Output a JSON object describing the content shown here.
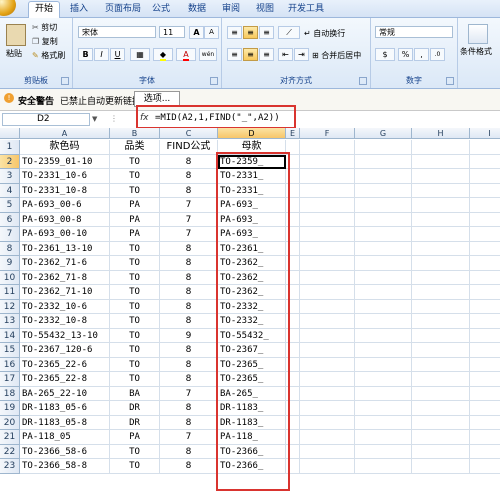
{
  "tabs": [
    "开始",
    "插入",
    "页面布局",
    "公式",
    "数据",
    "审阅",
    "视图",
    "开发工具"
  ],
  "ribbon": {
    "paste": "粘贴",
    "cut": "剪切",
    "copy": "复制",
    "format_painter": "格式刷",
    "clipboard_label": "剪贴板",
    "font_name": "宋体",
    "font_size": "11",
    "font_label": "字体",
    "bold": "B",
    "italic": "I",
    "underline": "U",
    "grow_font": "A",
    "shrink_font": "A",
    "wen": "wén",
    "font_color": "A",
    "wrap_text": "自动换行",
    "merge_center": "合并后居中",
    "alignment_label": "对齐方式",
    "number_format": "常规",
    "number_label": "数字",
    "percent": "%",
    "comma": ",",
    "cond_format": "条件格式",
    "currency": "$"
  },
  "security": {
    "title": "安全警告",
    "message": "已禁止自动更新链接",
    "options": "选项..."
  },
  "formula_bar": {
    "name_box": "D2",
    "fx": "fx",
    "formula": "=MID(A2,1,FIND(\"_\",A2))"
  },
  "columns": [
    "A",
    "B",
    "C",
    "D",
    "E",
    "F",
    "G",
    "H",
    "I"
  ],
  "headers": [
    "款色码",
    "品类",
    "FIND公式",
    "母款"
  ],
  "rows": [
    [
      "TO-2359_01-10",
      "TO",
      "8",
      "TO-2359_"
    ],
    [
      "TO-2331_10-6",
      "TO",
      "8",
      "TO-2331_"
    ],
    [
      "TO-2331_10-8",
      "TO",
      "8",
      "TO-2331_"
    ],
    [
      "PA-693_00-6",
      "PA",
      "7",
      "PA-693_"
    ],
    [
      "PA-693_00-8",
      "PA",
      "7",
      "PA-693_"
    ],
    [
      "PA-693_00-10",
      "PA",
      "7",
      "PA-693_"
    ],
    [
      "TO-2361_13-10",
      "TO",
      "8",
      "TO-2361_"
    ],
    [
      "TO-2362_71-6",
      "TO",
      "8",
      "TO-2362_"
    ],
    [
      "TO-2362_71-8",
      "TO",
      "8",
      "TO-2362_"
    ],
    [
      "TO-2362_71-10",
      "TO",
      "8",
      "TO-2362_"
    ],
    [
      "TO-2332_10-6",
      "TO",
      "8",
      "TO-2332_"
    ],
    [
      "TO-2332_10-8",
      "TO",
      "8",
      "TO-2332_"
    ],
    [
      "TO-55432_13-10",
      "TO",
      "9",
      "TO-55432_"
    ],
    [
      "TO-2367_120-6",
      "TO",
      "8",
      "TO-2367_"
    ],
    [
      "TO-2365_22-6",
      "TO",
      "8",
      "TO-2365_"
    ],
    [
      "TO-2365_22-8",
      "TO",
      "8",
      "TO-2365_"
    ],
    [
      "BA-265_22-10",
      "BA",
      "7",
      "BA-265_"
    ],
    [
      "DR-1183_05-6",
      "DR",
      "8",
      "DR-1183_"
    ],
    [
      "DR-1183_05-8",
      "DR",
      "8",
      "DR-1183_"
    ],
    [
      "PA-118_05",
      "PA",
      "7",
      "PA-118_"
    ],
    [
      "TO-2366_58-6",
      "TO",
      "8",
      "TO-2366_"
    ],
    [
      "TO-2366_58-8",
      "TO",
      "8",
      "TO-2366_"
    ]
  ]
}
